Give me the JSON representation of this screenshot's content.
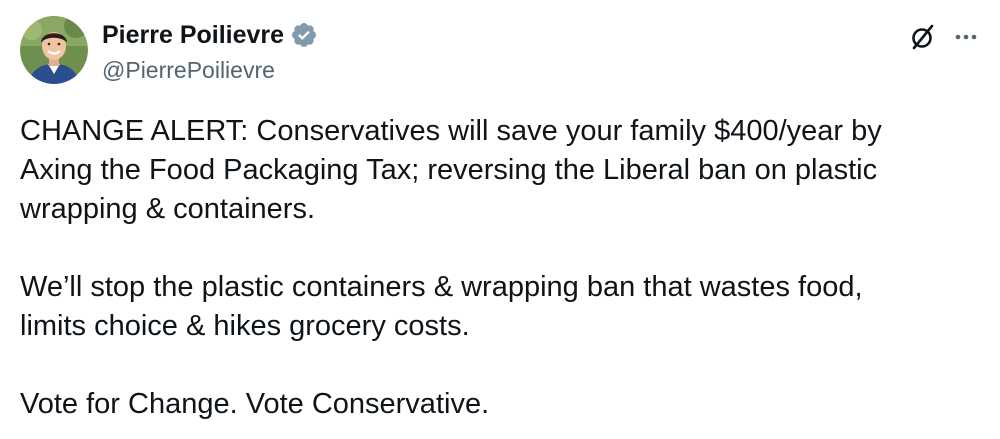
{
  "author": {
    "display_name": "Pierre Poilievre",
    "handle": "@PierrePoilievre",
    "verified_color": "#829aab"
  },
  "header_actions": {
    "grok_icon": "grok-slash-circle-icon",
    "more_icon": "more-horizontal-icon"
  },
  "tweet": {
    "paragraphs": [
      {
        "lines": [
          "CHANGE ALERT: Conservatives will save your family $400/year by",
          "Axing the Food Packaging Tax; reversing the Liberal ban on plastic",
          "wrapping & containers."
        ]
      },
      {
        "lines": [
          "We’ll stop the plastic containers & wrapping ban that wastes food,",
          "limits choice & hikes grocery costs."
        ]
      },
      {
        "lines": [
          "Vote for Change. Vote Conservative."
        ]
      }
    ]
  }
}
